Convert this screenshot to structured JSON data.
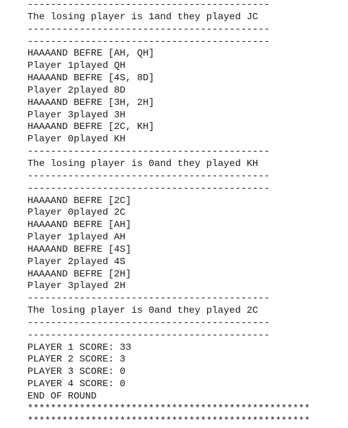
{
  "console": {
    "lines": [
      "------------------------------------------",
      "The losing player is 1and they played JC",
      "------------------------------------------",
      "------------------------------------------",
      "HAAAAND BEFRE [AH, QH]",
      "Player 1played QH",
      "HAAAAND BEFRE [4S, 8D]",
      "Player 2played 8D",
      "HAAAAND BEFRE [3H, 2H]",
      "Player 3played 3H",
      "HAAAAND BEFRE [2C, KH]",
      "Player 0played KH",
      "------------------------------------------",
      "The losing player is 0and they played KH",
      "------------------------------------------",
      "------------------------------------------",
      "HAAAAND BEFRE [2C]",
      "Player 0played 2C",
      "HAAAAND BEFRE [AH]",
      "Player 1played AH",
      "HAAAAND BEFRE [4S]",
      "Player 2played 4S",
      "HAAAAND BEFRE [2H]",
      "Player 3played 2H",
      "------------------------------------------",
      "The losing player is 0and they played 2C",
      "------------------------------------------",
      "------------------------------------------",
      "PLAYER 1 SCORE: 33",
      "PLAYER 2 SCORE: 3",
      "PLAYER 3 SCORE: 0",
      "PLAYER 4 SCORE: 0",
      "END OF ROUND",
      "*************************************************",
      "*************************************************"
    ]
  }
}
